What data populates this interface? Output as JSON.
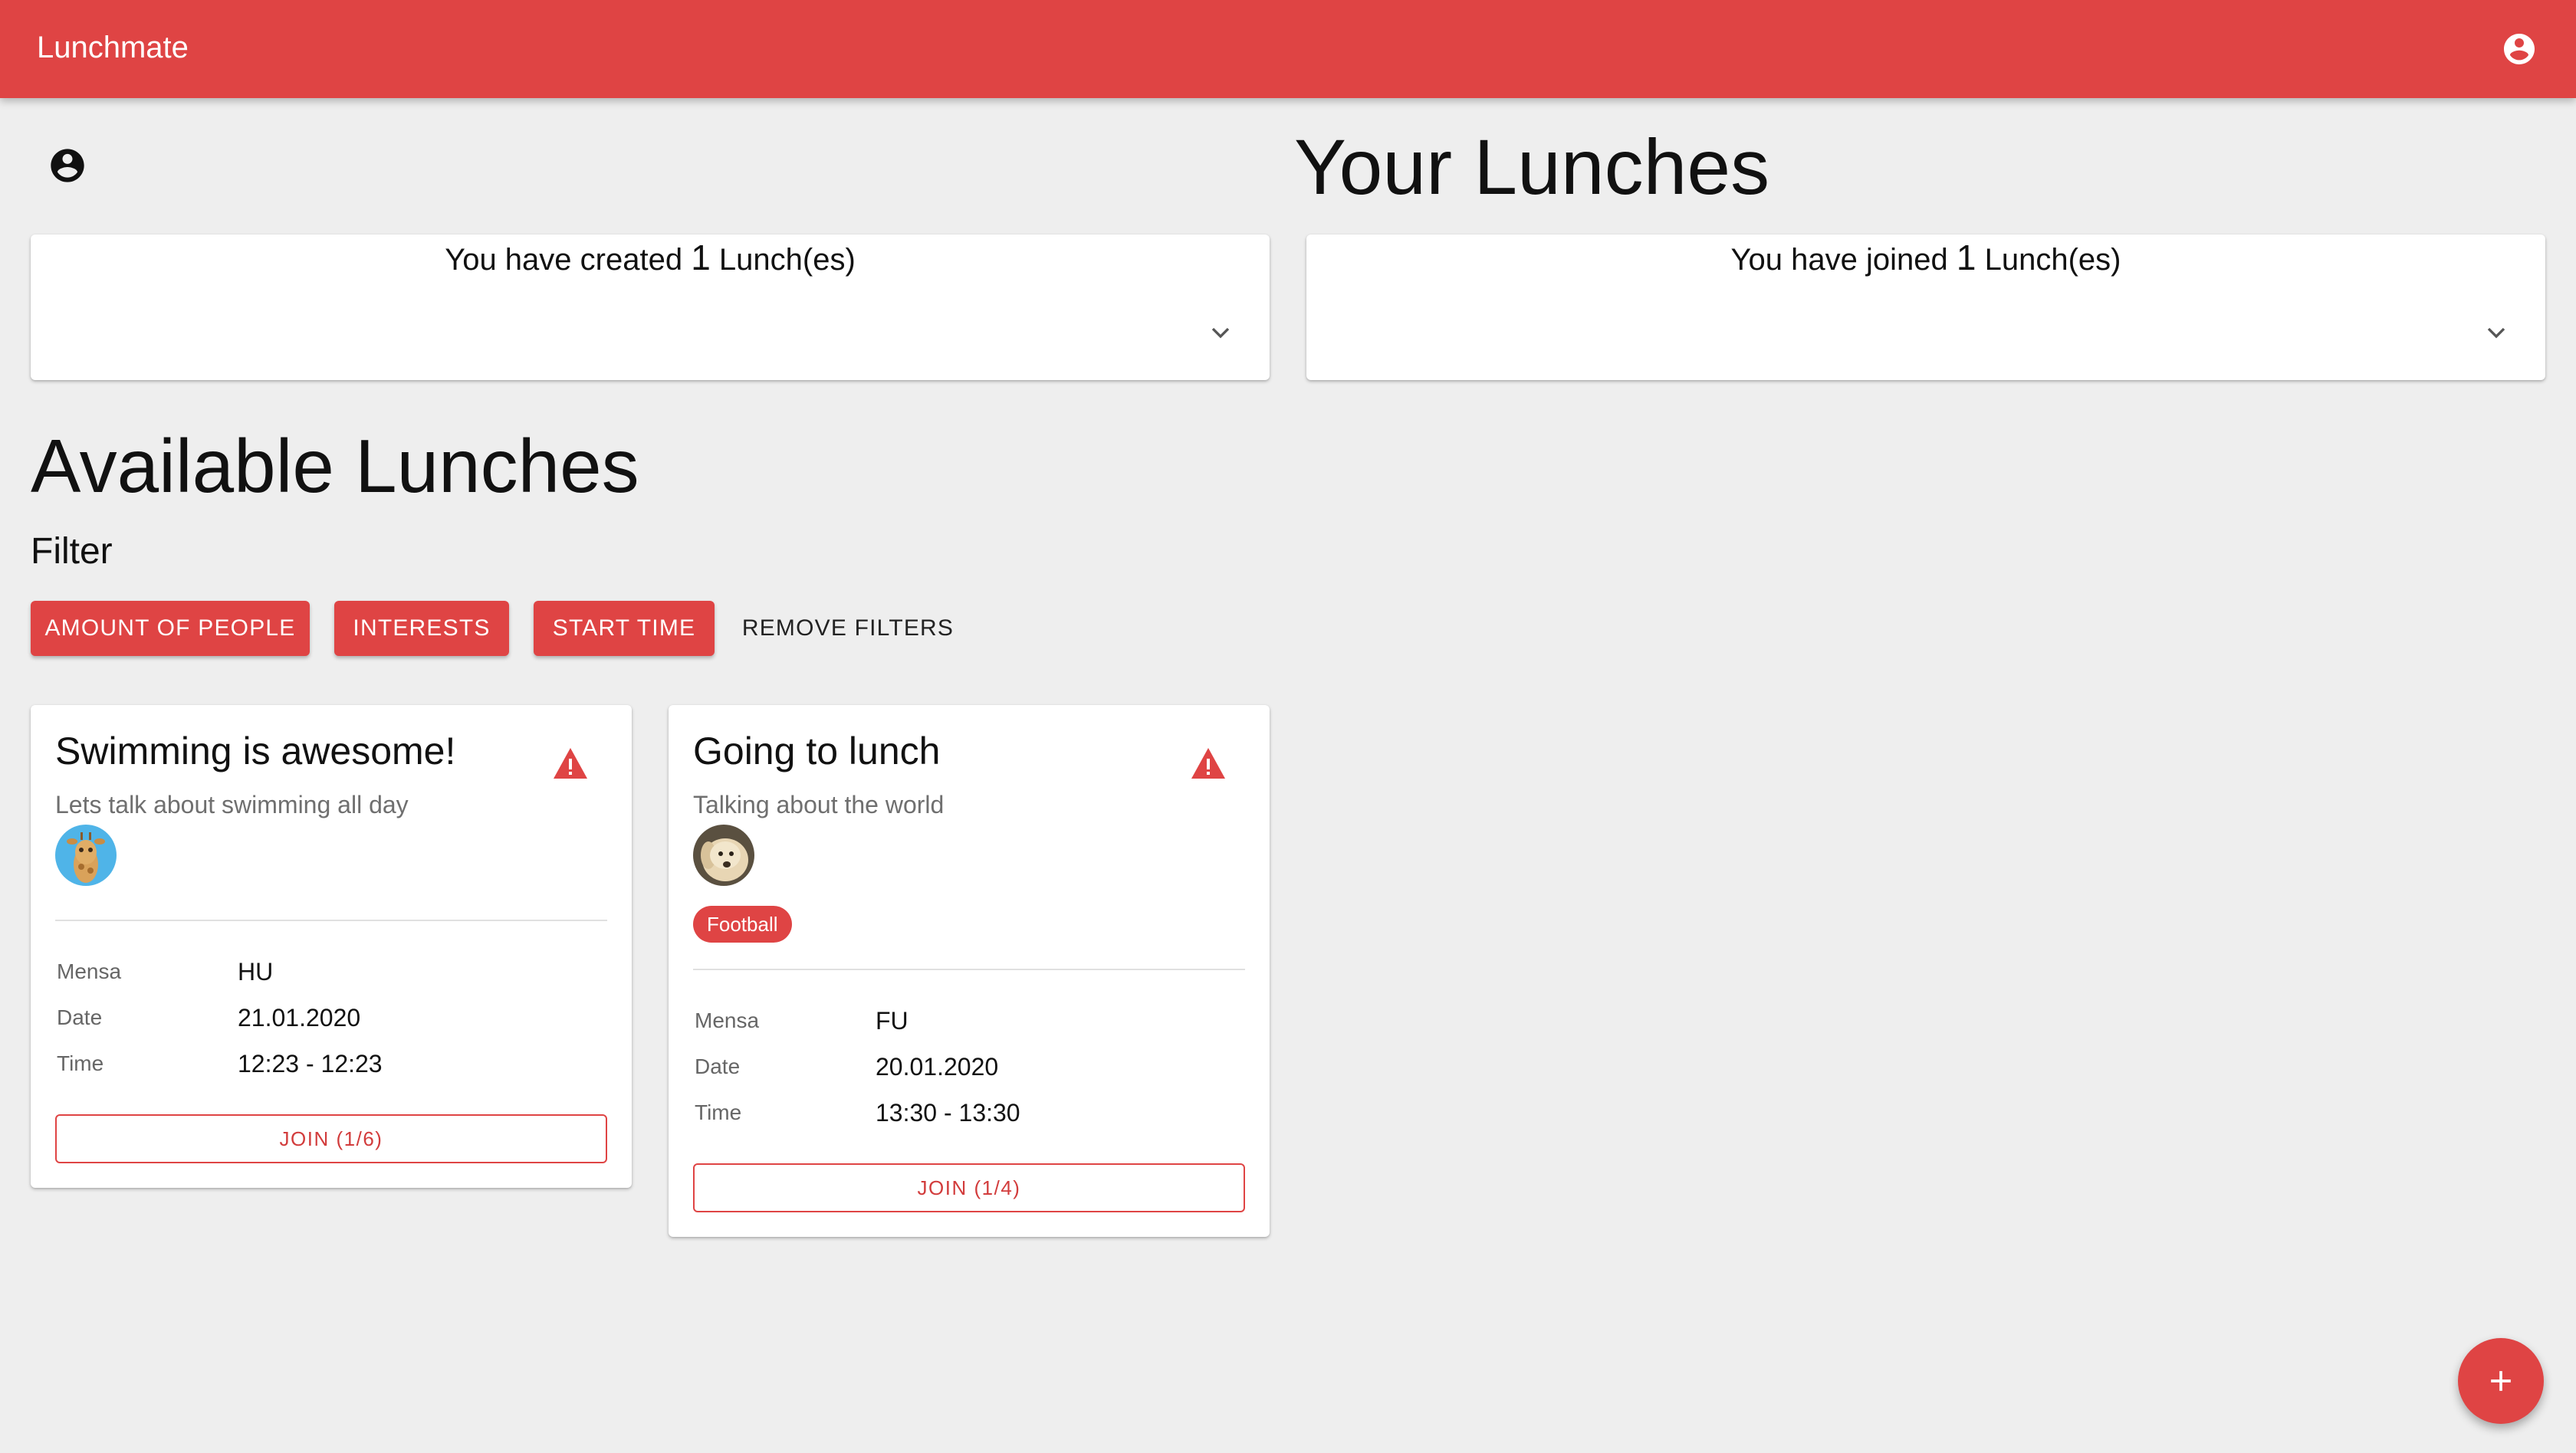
{
  "appbar": {
    "title": "Lunchmate",
    "account_icon": "account-circle-icon",
    "color": "#df4444"
  },
  "your_lunches": {
    "title": "Your Lunches",
    "created": {
      "prefix": "You have created",
      "count": "1",
      "suffix": "Lunch(es)"
    },
    "joined": {
      "prefix": "You have joined",
      "count": "1",
      "suffix": "Lunch(es)"
    }
  },
  "available": {
    "title": "Available Lunches",
    "filter_label": "Filter",
    "filters": {
      "amount_of_people": "AMOUNT OF PEOPLE",
      "interests": "INTERESTS",
      "start_time": "START TIME",
      "remove": "REMOVE FILTERS"
    }
  },
  "labels": {
    "mensa": "Mensa",
    "date": "Date",
    "time": "Time"
  },
  "lunches": [
    {
      "title": "Swimming is awesome!",
      "subtitle": "Lets talk about swimming all day",
      "avatar": "giraffe-avatar",
      "tags": [],
      "mensa": "HU",
      "date": "21.01.2020",
      "time": "12:23 - 12:23",
      "join_label": "JOIN (1/6)"
    },
    {
      "title": "Going to lunch",
      "subtitle": "Talking about the world",
      "avatar": "dog-avatar",
      "tags": [
        "Football"
      ],
      "mensa": "FU",
      "date": "20.01.2020",
      "time": "13:30 - 13:30",
      "join_label": "JOIN (1/4)"
    }
  ],
  "fab": {
    "icon": "plus-icon"
  }
}
